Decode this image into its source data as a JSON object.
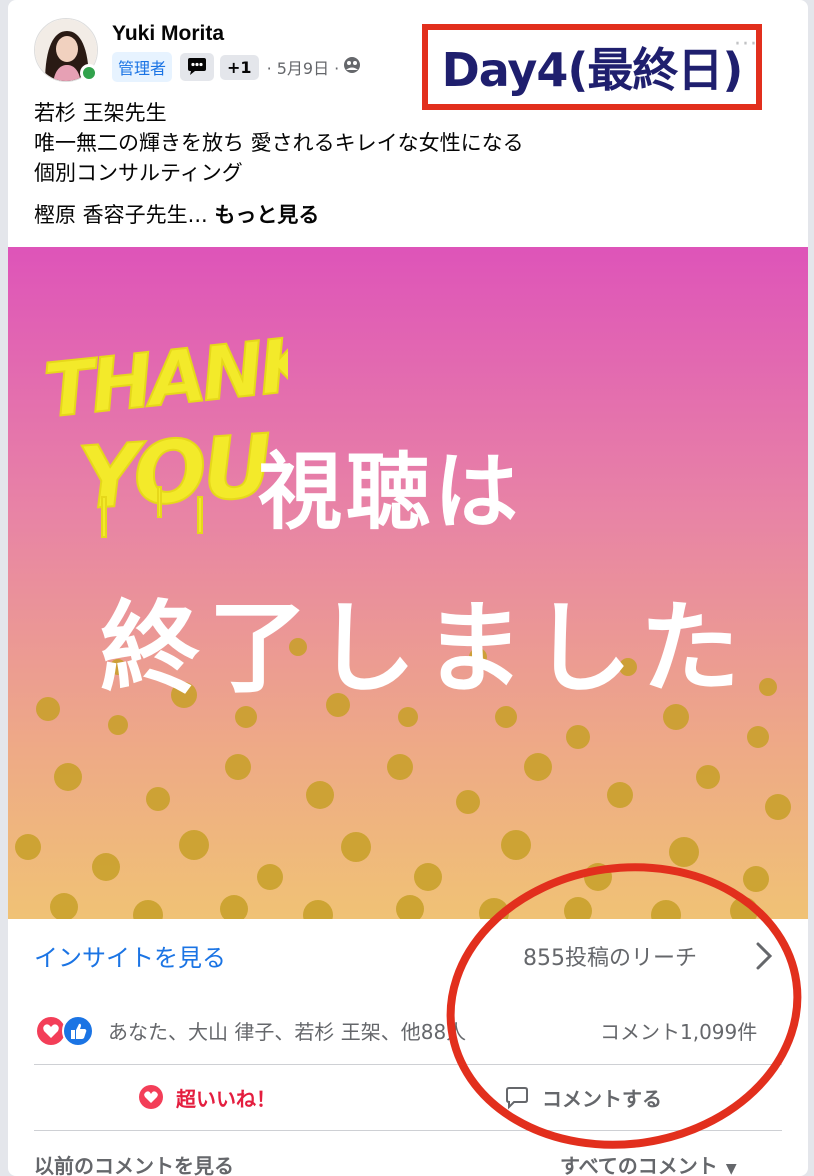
{
  "post": {
    "author": "Yuki Morita",
    "admin_badge": "管理者",
    "plus_badge": "+1",
    "date": "· 5月9日 ·",
    "menu": "···",
    "overlay_label": "Day4(最終日)",
    "text_lines": [
      "若杉 王架先生",
      "唯一無二の輝きを放ち 愛されるキレイな女性になる",
      "個別コンサルティング"
    ],
    "text_last": "樫原 香容子先生...",
    "see_more": "もっと見る"
  },
  "image": {
    "headline_1": "視聴は",
    "headline_2": "終了しました"
  },
  "stats": {
    "insights": "インサイトを見る",
    "reach": "855投稿のリーチ",
    "reactors": "あなた、大山 律子、若杉 王架、他88人",
    "comment_count": "コメント1,099件"
  },
  "actions": {
    "love": "超いいね！",
    "comment": "コメントする"
  },
  "footer": {
    "previous_comments": "以前のコメントを見る",
    "all_comments": "すべてのコメント"
  },
  "colors": {
    "accent_blue": "#1b74e4",
    "love_red": "#e41e3f",
    "annotation_red": "#e22f1d",
    "overlay_text": "#1f1f6e"
  }
}
